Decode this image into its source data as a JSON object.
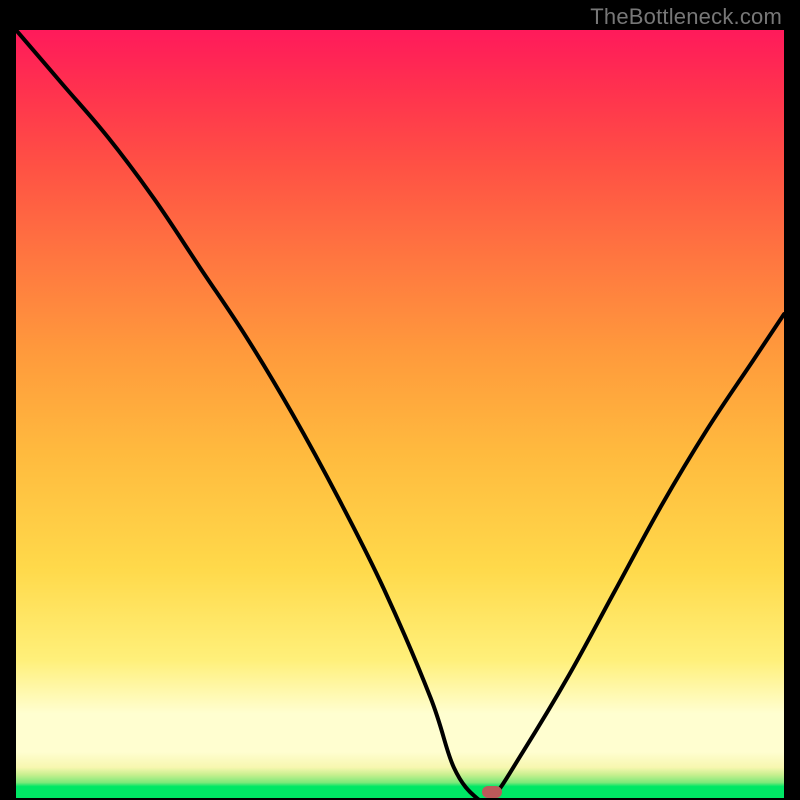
{
  "watermark": {
    "text": "TheBottleneck.com"
  },
  "colors": {
    "curve_stroke": "#000000",
    "marker_fill": "#bb5a5a",
    "background": "#000000"
  },
  "chart_data": {
    "type": "line",
    "title": "",
    "xlabel": "",
    "ylabel": "",
    "xlim": [
      0,
      100
    ],
    "ylim": [
      0,
      100
    ],
    "grid": false,
    "legend": false,
    "series": [
      {
        "name": "bottleneck-curve",
        "x": [
          0,
          6,
          12,
          18,
          24,
          30,
          36,
          42,
          48,
          54,
          57,
          60,
          62,
          66,
          72,
          78,
          84,
          90,
          96,
          100
        ],
        "values": [
          100,
          93,
          86,
          78,
          69,
          60,
          50,
          39,
          27,
          13,
          4,
          0,
          0,
          6,
          16,
          27,
          38,
          48,
          57,
          63
        ]
      }
    ],
    "annotations": {
      "marker": {
        "x": 62,
        "y": 0
      }
    }
  }
}
